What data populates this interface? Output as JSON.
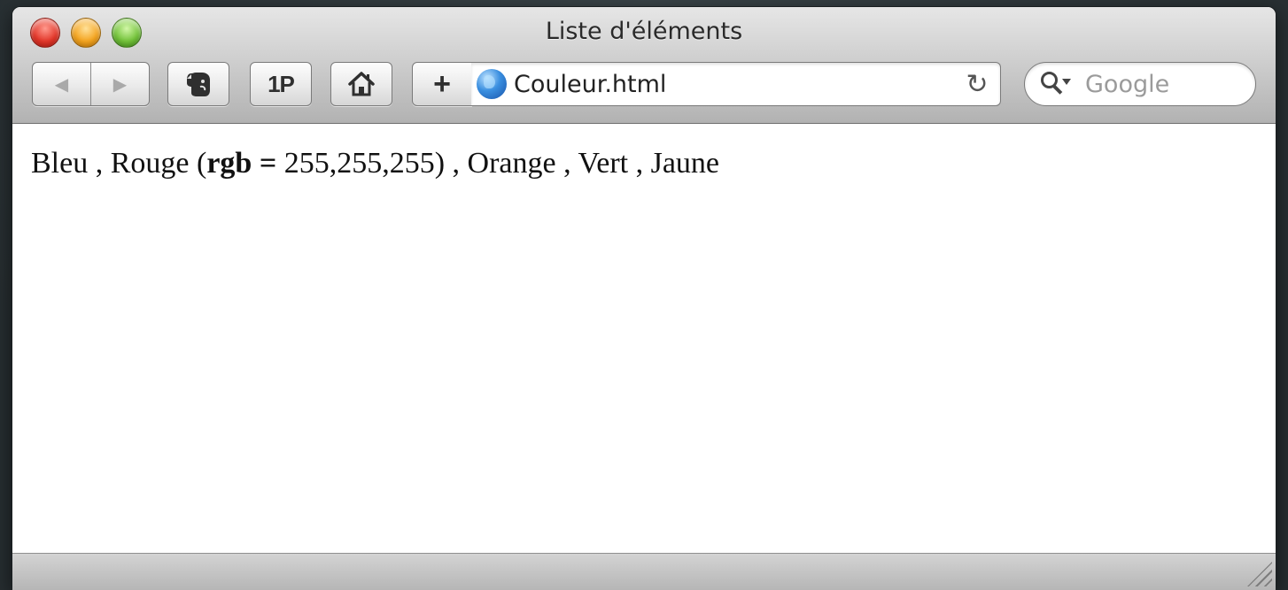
{
  "window": {
    "title": "Liste d'éléments"
  },
  "toolbar": {
    "back_icon": "◀",
    "forward_icon": "▶",
    "onepassword_label": "1P",
    "add_label": "+"
  },
  "address_bar": {
    "url": "Couleur.html",
    "reload_icon": "↻"
  },
  "search": {
    "placeholder": "Google"
  },
  "content": {
    "seg1": "Bleu , Rouge (",
    "seg2_bold": "rgb =",
    "seg3": " 255,255,255) , Orange , Vert , Jaune"
  }
}
